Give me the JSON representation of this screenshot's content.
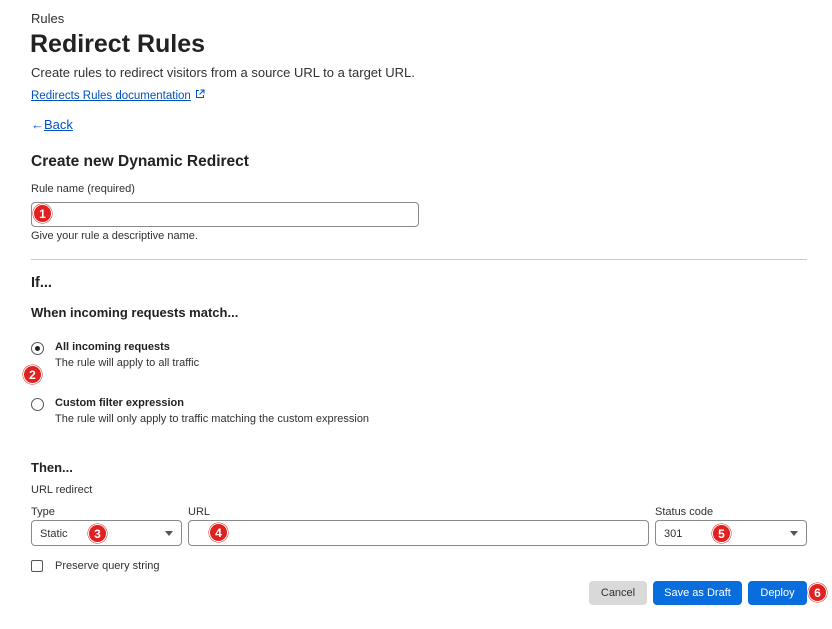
{
  "breadcrumb": "Rules",
  "page_title": "Redirect Rules",
  "description": "Create rules to redirect visitors from a source URL to a target URL.",
  "doc_link": "Redirects Rules documentation",
  "back_arrow": "←",
  "back_label": "Back",
  "section_title": "Create new Dynamic Redirect",
  "rule_name": {
    "label": "Rule name (required)",
    "value": "",
    "placeholder": "",
    "help": "Give your rule a descriptive name."
  },
  "if_section": {
    "title": "If...",
    "subtitle": "When incoming requests match...",
    "options": [
      {
        "title": "All incoming requests",
        "description": "The rule will apply to all traffic",
        "selected": true
      },
      {
        "title": "Custom filter expression",
        "description": "The rule will only apply to traffic matching the custom expression",
        "selected": false
      }
    ]
  },
  "then_section": {
    "title": "Then...",
    "subtitle": "URL redirect",
    "type_label": "Type",
    "type_value": "Static",
    "url_label": "URL",
    "url_value": "",
    "status_label": "Status code",
    "status_value": "301",
    "preserve_label": "Preserve query string",
    "preserve_checked": false
  },
  "buttons": {
    "cancel": "Cancel",
    "save_draft": "Save as Draft",
    "deploy": "Deploy"
  },
  "badges": [
    "1",
    "2",
    "3",
    "4",
    "5",
    "6"
  ],
  "colors": {
    "link": "#0051c3",
    "primary": "#0a6dde",
    "badge": "#e0211f"
  }
}
